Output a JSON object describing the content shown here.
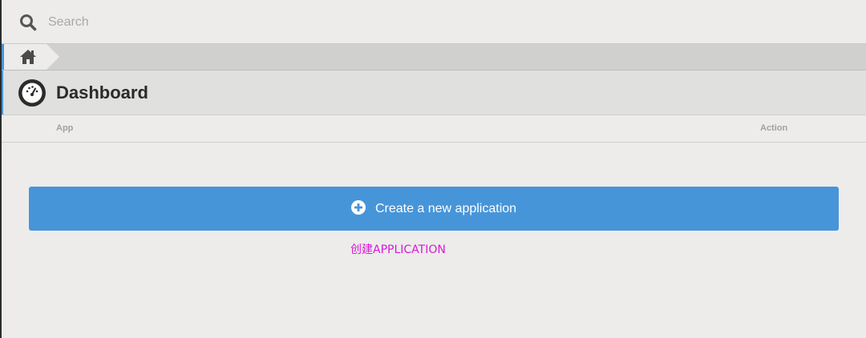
{
  "search": {
    "placeholder": "Search"
  },
  "breadcrumb": {
    "home_icon": "home-icon"
  },
  "header": {
    "title": "Dashboard",
    "icon": "dashboard-icon"
  },
  "table": {
    "columns": [
      "App",
      "Action"
    ]
  },
  "actions": {
    "create_label": "Create a new application",
    "create_icon": "plus-circle-icon"
  },
  "note": "创建APPLICATION",
  "colors": {
    "accent": "#4795d9",
    "note": "#d719d7",
    "background": "#edecea"
  }
}
